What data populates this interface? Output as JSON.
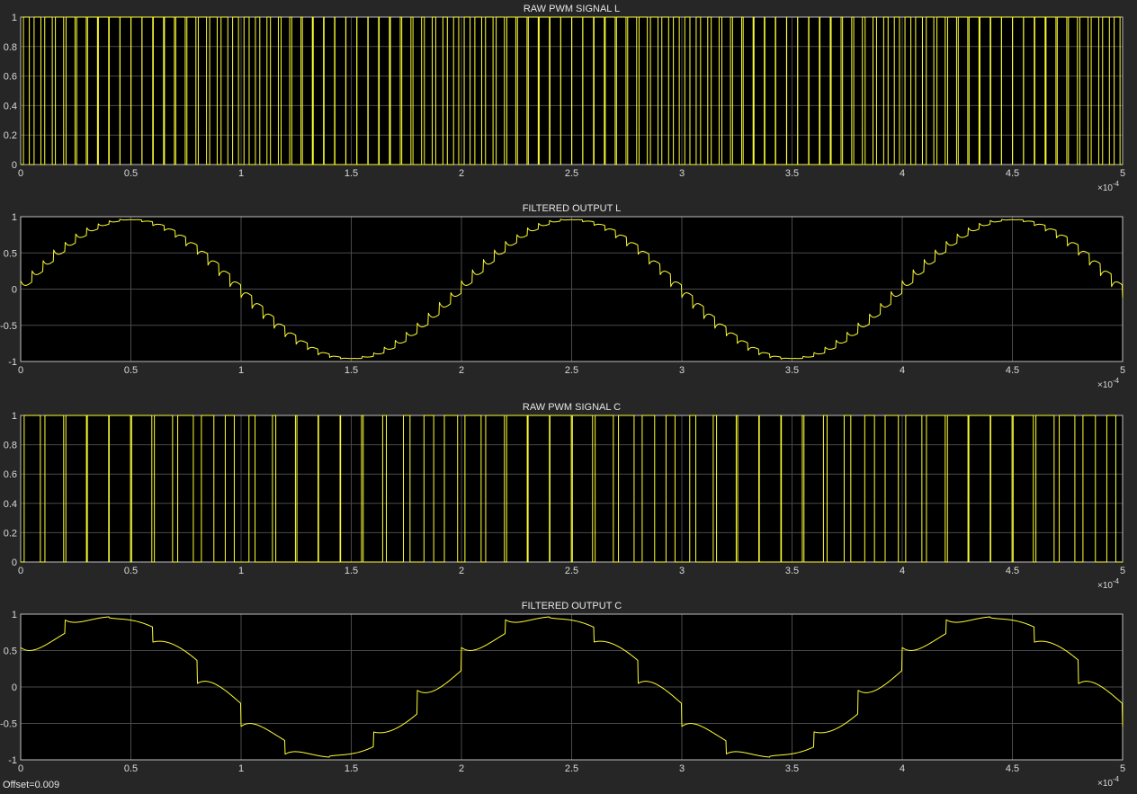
{
  "window": {
    "background_color": "#262626",
    "plot_background_color": "#000000",
    "trace_color": "#ffff33",
    "grid_color": "#4a4a4a",
    "status_offset": "Offset=0.009"
  },
  "chart_data": [
    {
      "type": "line",
      "title": "RAW PWM SIGNAL L",
      "xlim": [
        0,
        0.0005
      ],
      "ylim": [
        0,
        1
      ],
      "x_ticks": [
        0,
        0.5,
        1,
        1.5,
        2,
        2.5,
        3,
        3.5,
        4,
        4.5,
        5
      ],
      "y_ticks": [
        0,
        0.2,
        0.4,
        0.6,
        0.8,
        1
      ],
      "x_multiplier": "×10",
      "x_multiplier_exp": "-4",
      "grid": true,
      "signal": {
        "kind": "pwm",
        "carrier_periods": 100,
        "reference_periods": 2.5,
        "reference_amplitude": 0.96,
        "reference_phase_deg": 0,
        "low": 0,
        "high": 1
      }
    },
    {
      "type": "line",
      "title": "FILTERED OUTPUT L",
      "xlim": [
        0,
        0.0005
      ],
      "ylim": [
        -1,
        1
      ],
      "x_ticks": [
        0,
        0.5,
        1,
        1.5,
        2,
        2.5,
        3,
        3.5,
        4,
        4.5,
        5
      ],
      "y_ticks": [
        -1,
        -0.5,
        0,
        0.5,
        1
      ],
      "x_multiplier": "×10",
      "x_multiplier_exp": "-4",
      "grid": true,
      "signal": {
        "kind": "filtered",
        "carrier_periods": 100,
        "reference_periods": 2.5,
        "reference_amplitude": 0.96,
        "reference_phase_deg": 0,
        "ripple": 0.18,
        "low": -1,
        "high": 1
      }
    },
    {
      "type": "line",
      "title": "RAW PWM SIGNAL C",
      "xlim": [
        0,
        0.0005
      ],
      "ylim": [
        0,
        1
      ],
      "x_ticks": [
        0,
        0.5,
        1,
        1.5,
        2,
        2.5,
        3,
        3.5,
        4,
        4.5,
        5
      ],
      "y_ticks": [
        0,
        0.2,
        0.4,
        0.6,
        0.8,
        1
      ],
      "x_multiplier": "×10",
      "x_multiplier_exp": "-4",
      "grid": true,
      "signal": {
        "kind": "pwm",
        "carrier_periods": 50,
        "reference_periods": 2.5,
        "reference_amplitude": 0.96,
        "reference_phase_deg": 20,
        "low": 0,
        "high": 1
      }
    },
    {
      "type": "line",
      "title": "FILTERED OUTPUT C",
      "xlim": [
        0,
        0.0005
      ],
      "ylim": [
        -1,
        1
      ],
      "x_ticks": [
        0,
        0.5,
        1,
        1.5,
        2,
        2.5,
        3,
        3.5,
        4,
        4.5,
        5
      ],
      "y_ticks": [
        -1,
        -0.5,
        0,
        0.5,
        1
      ],
      "x_multiplier": "×10",
      "x_multiplier_exp": "-4",
      "grid": true,
      "signal": {
        "kind": "filtered",
        "carrier_periods": 25,
        "reference_periods": 2.5,
        "reference_amplitude": 0.96,
        "reference_phase_deg": 20,
        "ripple": 0.35,
        "low": -1,
        "high": 1
      }
    }
  ]
}
